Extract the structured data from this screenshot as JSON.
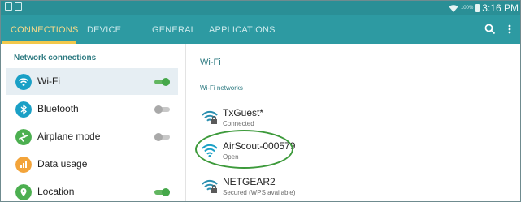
{
  "status_bar": {
    "battery": "100%",
    "time": "3:16 PM"
  },
  "tabs": [
    {
      "label": "CONNECTIONS",
      "active": true
    },
    {
      "label": "DEVICE",
      "active": false
    },
    {
      "label": "GENERAL",
      "active": false
    },
    {
      "label": "APPLICATIONS",
      "active": false
    }
  ],
  "left_panel": {
    "header": "Network connections",
    "items": [
      {
        "label": "Wi-Fi",
        "icon": "wifi-icon",
        "color": "#1aa0c6",
        "toggle": true,
        "selected": true
      },
      {
        "label": "Bluetooth",
        "icon": "bluetooth-icon",
        "color": "#1aa0c6",
        "toggle": false
      },
      {
        "label": "Airplane mode",
        "icon": "airplane-icon",
        "color": "#4caf50",
        "toggle": false
      },
      {
        "label": "Data usage",
        "icon": "data-usage-icon",
        "color": "#f3a43a"
      },
      {
        "label": "Location",
        "icon": "location-icon",
        "color": "#4caf50",
        "toggle": true
      }
    ]
  },
  "right_panel": {
    "title": "Wi-Fi",
    "subtitle": "Wi-Fi networks",
    "networks": [
      {
        "name": "TxGuest*",
        "status": "Connected",
        "locked": true
      },
      {
        "name": "AirScout-000579",
        "status": "Open",
        "locked": false,
        "highlighted": true
      },
      {
        "name": "NETGEAR2",
        "status": "Secured (WPS available)",
        "locked": true
      }
    ]
  },
  "colors": {
    "accent": "#2d9aa2",
    "tab_active": "#f2c84b",
    "toggle_on": "#46a84a",
    "highlight": "#3d9a3b"
  }
}
